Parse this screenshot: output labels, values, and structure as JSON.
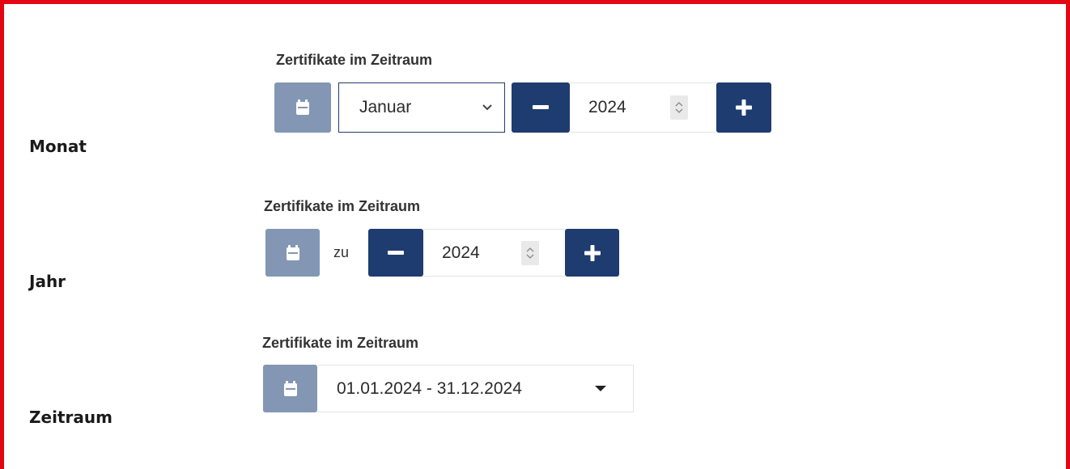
{
  "rows": [
    {
      "label": "Monat",
      "caption": "Zertifikate im Zeitraum",
      "month_select": {
        "value": "Januar"
      },
      "year": {
        "value": "2024"
      }
    },
    {
      "label": "Jahr",
      "caption": "Zertifikate im Zeitraum",
      "zu_text": "zu",
      "year": {
        "value": "2024"
      }
    },
    {
      "label": "Zeitraum",
      "caption": "Zertifikate im Zeitraum",
      "range": {
        "value": "01.01.2024 - 31.12.2024"
      }
    }
  ],
  "colors": {
    "frame": "#e30613",
    "calendar_button": "#8396b4",
    "stepper_button": "#1f3c70",
    "select_border": "#1f3c70"
  },
  "icons": [
    "calendar-icon",
    "chevron-down-icon",
    "minus-icon",
    "plus-icon",
    "spinner-icon",
    "caret-down-icon"
  ]
}
